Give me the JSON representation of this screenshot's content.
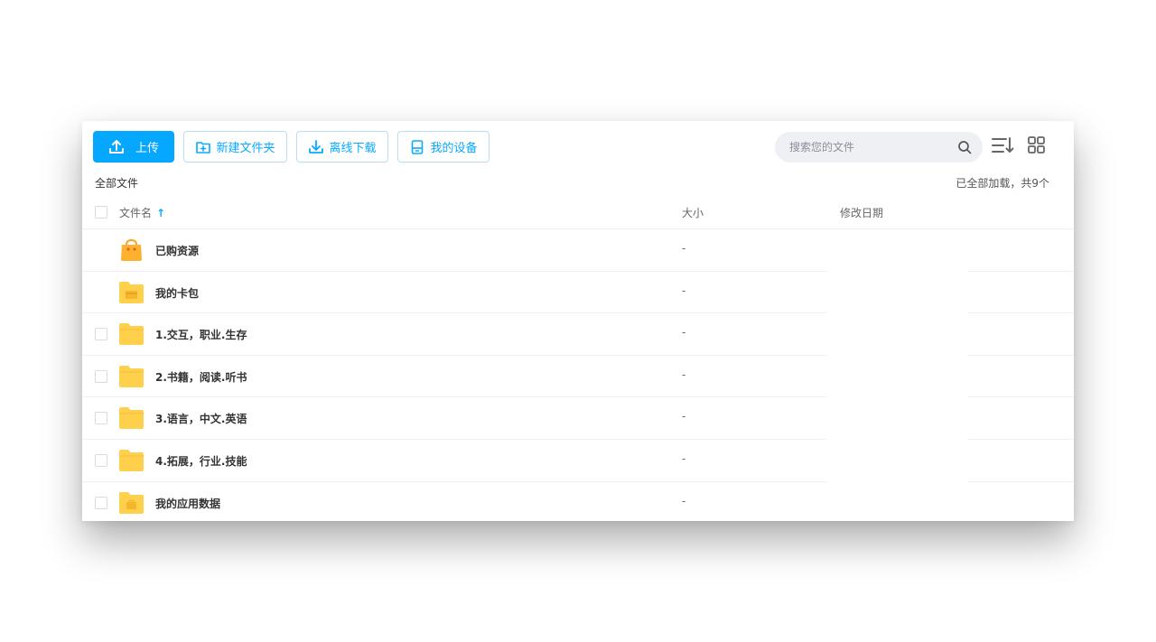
{
  "toolbar": {
    "upload_label": "上传",
    "new_folder_label": "新建文件夹",
    "offline_download_label": "离线下载",
    "my_devices_label": "我的设备"
  },
  "search": {
    "placeholder": "搜索您的文件"
  },
  "breadcrumb": {
    "label": "全部文件"
  },
  "status": {
    "loaded_text": "已全部加载，共9个"
  },
  "table": {
    "columns": {
      "name": "文件名",
      "size": "大小",
      "modified": "修改日期"
    },
    "rows": [
      {
        "name": "已购资源",
        "size": "-",
        "icon": "purchased-bag-icon"
      },
      {
        "name": "我的卡包",
        "size": "-",
        "icon": "card-folder-icon"
      },
      {
        "name": "1.交互，职业.生存",
        "size": "-",
        "icon": "folder-icon"
      },
      {
        "name": "2.书籍，阅读.听书",
        "size": "-",
        "icon": "folder-icon"
      },
      {
        "name": "3.语言，中文.英语",
        "size": "-",
        "icon": "folder-icon"
      },
      {
        "name": "4.拓展，行业.技能",
        "size": "-",
        "icon": "folder-icon"
      },
      {
        "name": "我的应用数据",
        "size": "-",
        "icon": "app-data-folder-icon"
      }
    ]
  },
  "colors": {
    "accent": "#06a7ff",
    "folder": "#FFD04B",
    "folder_dark": "#F5B62D"
  }
}
